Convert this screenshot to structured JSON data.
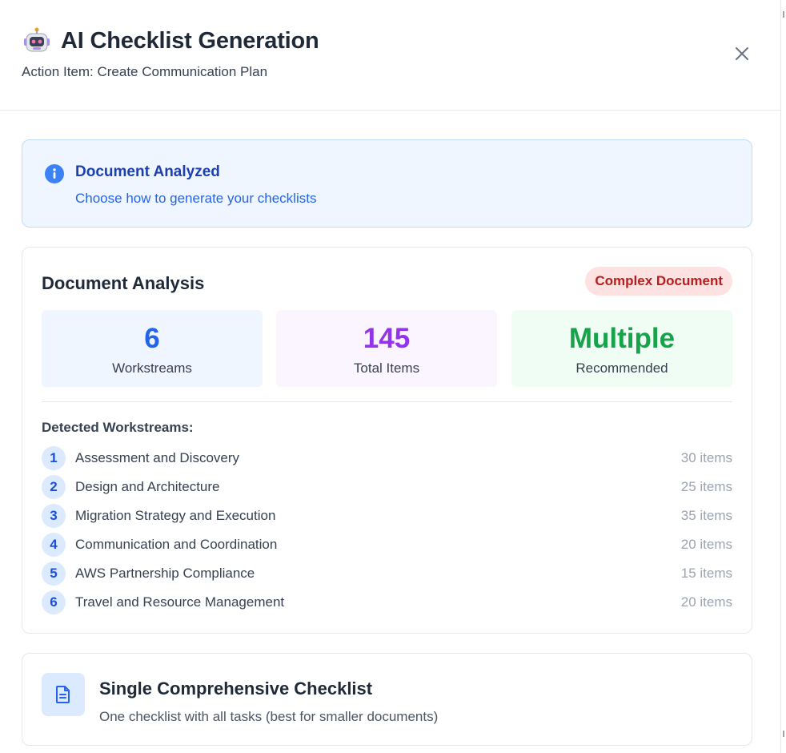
{
  "header": {
    "title": "AI Checklist Generation",
    "subtitle": "Action Item: Create Communication Plan",
    "icon": "robot-icon",
    "close_icon": "close-icon"
  },
  "info": {
    "title": "Document Analyzed",
    "description": "Choose how to generate your checklists",
    "icon": "info-icon"
  },
  "analysis": {
    "title": "Document Analysis",
    "badge": "Complex Document",
    "stats": [
      {
        "value": "6",
        "label": "Workstreams",
        "color": "#2563eb"
      },
      {
        "value": "145",
        "label": "Total Items",
        "color": "#9333ea"
      },
      {
        "value": "Multiple",
        "label": "Recommended",
        "color": "#16a34a"
      }
    ],
    "workstreams_heading": "Detected Workstreams:",
    "workstreams": [
      {
        "num": "1",
        "name": "Assessment and Discovery",
        "count": "30 items"
      },
      {
        "num": "2",
        "name": "Design and Architecture",
        "count": "25 items"
      },
      {
        "num": "3",
        "name": "Migration Strategy and Execution",
        "count": "35 items"
      },
      {
        "num": "4",
        "name": "Communication and Coordination",
        "count": "20 items"
      },
      {
        "num": "5",
        "name": "AWS Partnership Compliance",
        "count": "15 items"
      },
      {
        "num": "6",
        "name": "Travel and Resource Management",
        "count": "20 items"
      }
    ]
  },
  "option": {
    "title": "Single Comprehensive Checklist",
    "description": "One checklist with all tasks (best for smaller documents)",
    "icon": "document-icon"
  },
  "colors": {
    "accent": "#2563eb",
    "danger": "#b91c1c",
    "success": "#16a34a",
    "purple": "#9333ea"
  }
}
